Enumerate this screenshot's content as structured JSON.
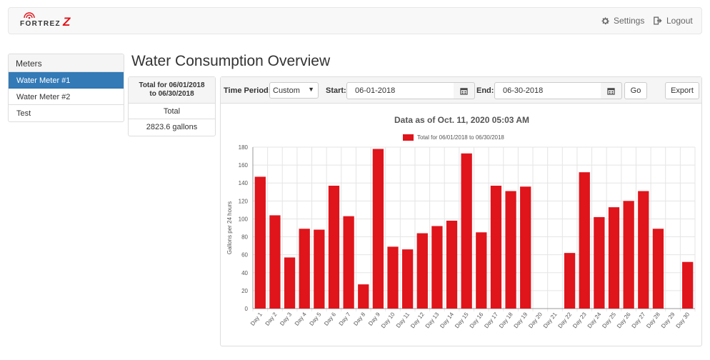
{
  "header": {
    "logo_text": "FORTREZ",
    "logo_z": "Z",
    "settings_label": "Settings",
    "logout_label": "Logout"
  },
  "sidebar": {
    "title": "Meters",
    "items": [
      {
        "label": "Water Meter #1",
        "active": true
      },
      {
        "label": "Water Meter #2",
        "active": false
      },
      {
        "label": "Test",
        "active": false
      }
    ]
  },
  "page_title": "Water Consumption Overview",
  "totals": {
    "heading_line1": "Total for 06/01/2018",
    "heading_line2": "to 06/30/2018",
    "label": "Total",
    "value": "2823.6 gallons"
  },
  "toolbar": {
    "time_period_label": "Time Period:",
    "time_period_value": "Custom",
    "start_label": "Start:",
    "start_value": "06-01-2018",
    "end_label": "End:",
    "end_value": "06-30-2018",
    "go_label": "Go",
    "export_label": "Export"
  },
  "colors": {
    "bar": "#e0141b",
    "active_item": "#337ab7"
  },
  "chart_data": {
    "type": "bar",
    "title": "Data as of Oct. 11, 2020 05:03 AM",
    "ylabel": "Gallons per 24 hours",
    "xlabel": "",
    "ylim": [
      0,
      180
    ],
    "yticks": [
      0,
      20,
      40,
      60,
      80,
      100,
      120,
      140,
      160,
      180
    ],
    "grid": true,
    "legend_position": "top",
    "categories": [
      "Day 1",
      "Day 2",
      "Day 3",
      "Day 4",
      "Day 5",
      "Day 6",
      "Day 7",
      "Day 8",
      "Day 9",
      "Day 10",
      "Day 11",
      "Day 12",
      "Day 13",
      "Day 14",
      "Day 15",
      "Day 16",
      "Day 17",
      "Day 18",
      "Day 19",
      "Day 20",
      "Day 21",
      "Day 22",
      "Day 23",
      "Day 24",
      "Day 25",
      "Day 26",
      "Day 27",
      "Day 28",
      "Day 29",
      "Day 30"
    ],
    "series": [
      {
        "name": "Total for 06/01/2018 to 06/30/2018",
        "values": [
          147,
          104,
          57,
          89,
          88,
          137,
          103,
          27,
          178,
          69,
          66,
          84,
          92,
          98,
          173,
          85,
          137,
          131,
          136,
          0,
          0,
          62,
          152,
          102,
          113,
          120,
          131,
          89,
          0,
          52
        ]
      }
    ]
  }
}
